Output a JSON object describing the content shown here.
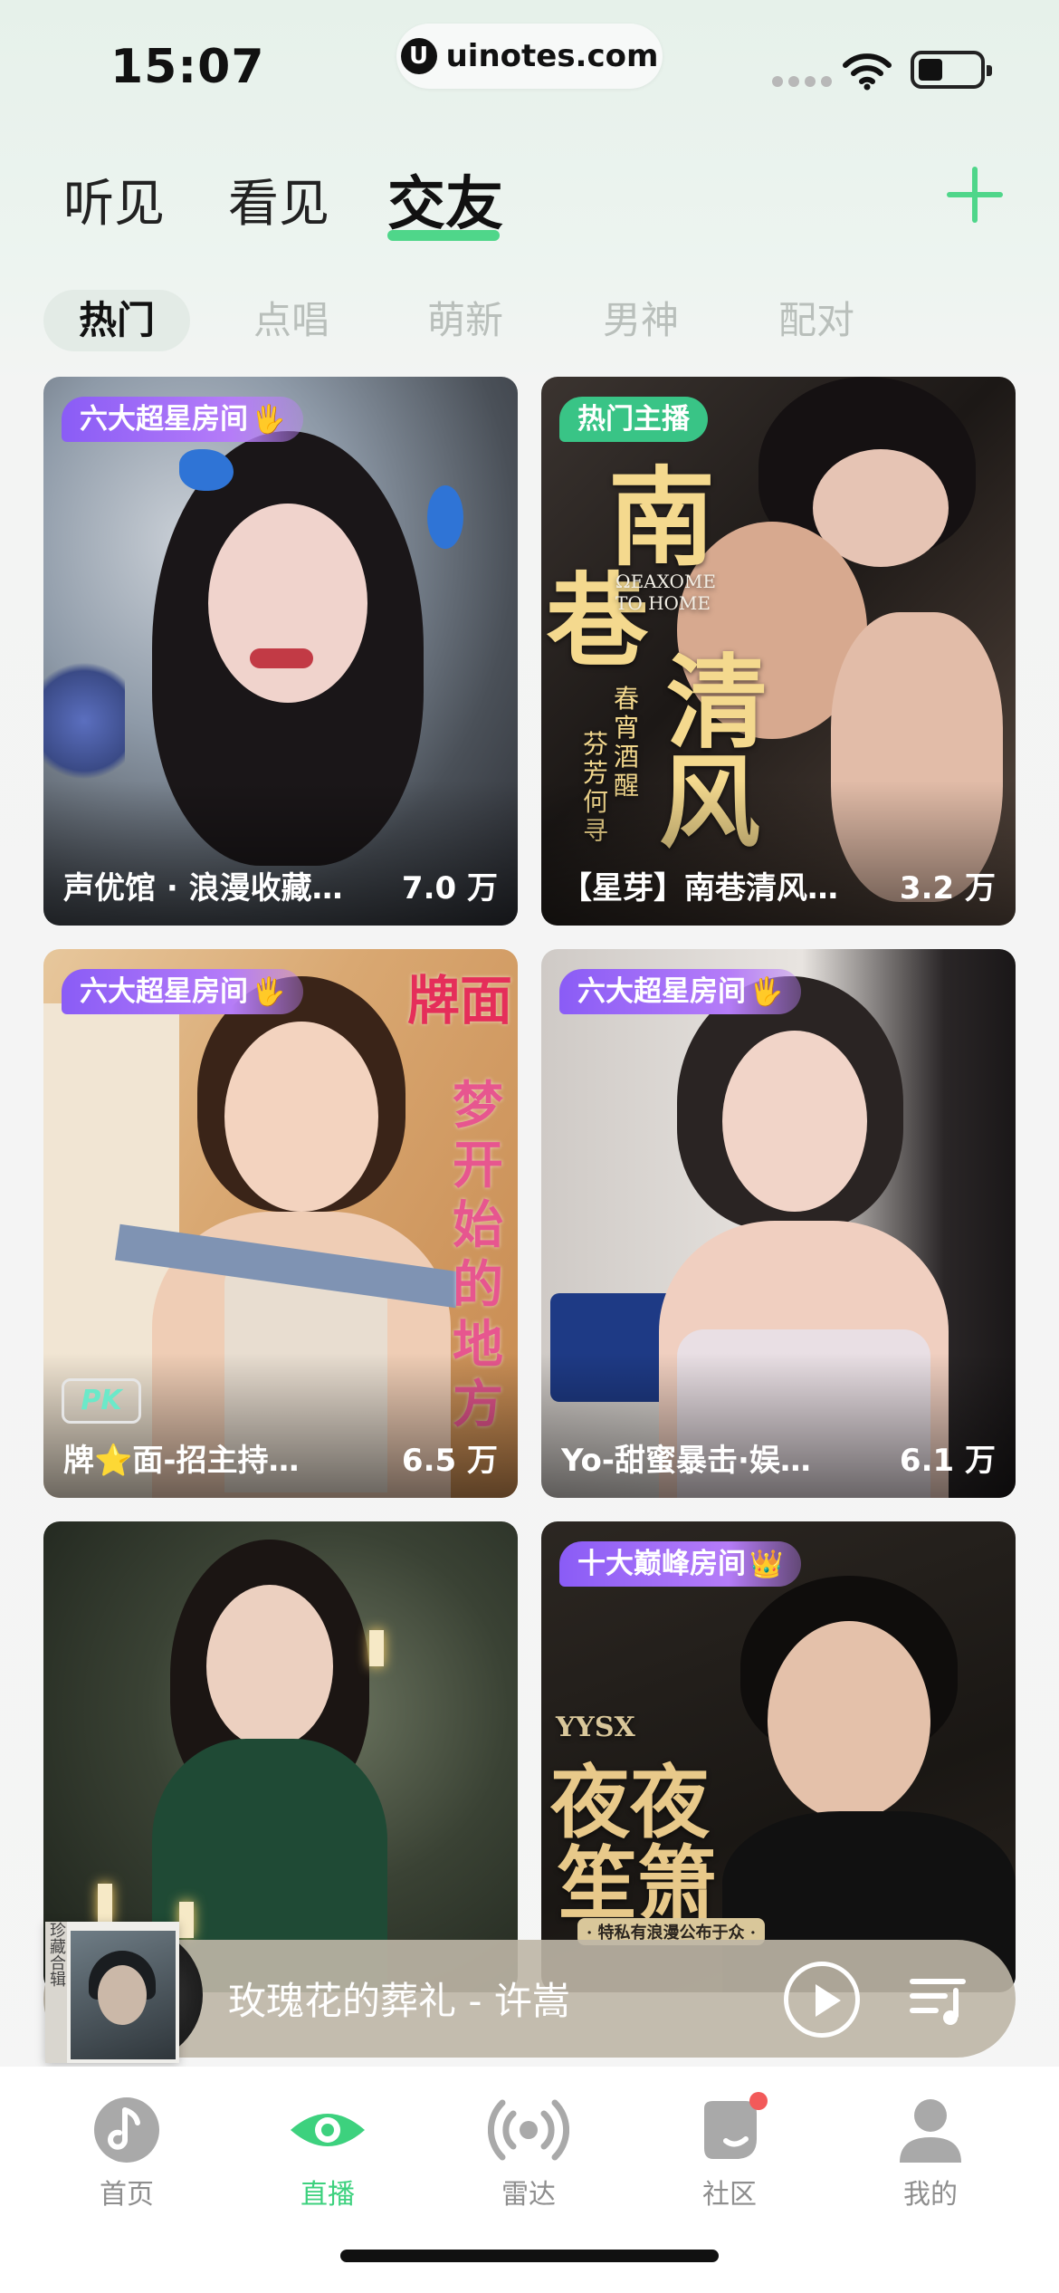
{
  "status_bar": {
    "time": "15:07",
    "url": "uinotes.com",
    "url_icon": "U"
  },
  "top_tabs": [
    {
      "label": "听见"
    },
    {
      "label": "看见"
    },
    {
      "label": "交友"
    }
  ],
  "active_top_tab": "交友",
  "sub_tabs": [
    {
      "label": "热门"
    },
    {
      "label": "点唱"
    },
    {
      "label": "萌新"
    },
    {
      "label": "男神"
    },
    {
      "label": "配对"
    }
  ],
  "active_sub_tab": "热门",
  "cards": [
    {
      "badge": "六大超星房间",
      "badge_style": "purple",
      "title": "声优馆 · 浪漫收藏…",
      "count": "7.0 万"
    },
    {
      "badge": "热门主播",
      "badge_style": "green",
      "title": "【星芽】南巷清风…",
      "count": "3.2 万",
      "poster": {
        "big1": "南",
        "big2": "巷",
        "big3": "清",
        "big4": "风",
        "en": "ΩEAXOME TO HOME",
        "small": "春宵酒醒",
        "small2": "芬芳何寻"
      }
    },
    {
      "badge": "六大超星房间",
      "badge_style": "purple",
      "title": "牌⭐面-招主持…",
      "count": "6.5 万",
      "pk": "PK",
      "side_top": "牌面",
      "side_col": "梦开始的地方"
    },
    {
      "badge": "六大超星房间",
      "badge_style": "purple",
      "title": "Yo-甜蜜暴击·娱…",
      "count": "6.1 万"
    },
    {
      "badge": "",
      "badge_style": "",
      "title": "",
      "count": ""
    },
    {
      "badge": "十大巅峰房间",
      "badge_style": "purple",
      "title": "",
      "count": "",
      "poster": {
        "en": "YYSX",
        "line1": "夜夜",
        "line2": "笙箫",
        "small": "· 特私有浪漫公布于众 ·"
      }
    }
  ],
  "player": {
    "song": "玫瑰花的葬礼 - 许嵩",
    "album_spine": "珍藏合辑"
  },
  "bottom_nav": [
    {
      "label": "首页",
      "icon": "music-note-icon"
    },
    {
      "label": "直播",
      "icon": "eye-icon"
    },
    {
      "label": "雷达",
      "icon": "radar-icon"
    },
    {
      "label": "社区",
      "icon": "community-icon"
    },
    {
      "label": "我的",
      "icon": "profile-icon"
    }
  ],
  "colors": {
    "accent": "#3dd17e",
    "badge_purple": "#8a5cf6",
    "badge_green": "#39c486",
    "player_bg": "#beb6a6",
    "notify_dot": "#f25a5a"
  }
}
